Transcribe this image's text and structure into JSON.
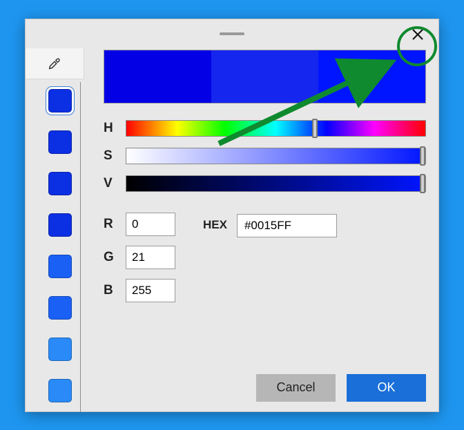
{
  "selected_color_hex": "#0015FF",
  "preview": {
    "c1": "#0400e6",
    "c2": "#1526ee",
    "c3": "#0015ff"
  },
  "swatch_colors": [
    "#0b2fe3",
    "#0b2fe3",
    "#0b2fe3",
    "#0b2fe3",
    "#1a60f5",
    "#1a60f5",
    "#2a8af7",
    "#2a8af7"
  ],
  "selected_swatch_index": 0,
  "sliders": {
    "h": {
      "label": "H",
      "thumb_pct": 63
    },
    "s": {
      "label": "S",
      "thumb_pct": 99
    },
    "v": {
      "label": "V",
      "thumb_pct": 99
    }
  },
  "inputs": {
    "r": {
      "label": "R",
      "value": "0"
    },
    "g": {
      "label": "G",
      "value": "21"
    },
    "b": {
      "label": "B",
      "value": "255"
    },
    "hex": {
      "label": "HEX",
      "value": "#0015FF"
    }
  },
  "buttons": {
    "cancel": "Cancel",
    "ok": "OK"
  },
  "annotation": {
    "highlight": "close-button"
  }
}
